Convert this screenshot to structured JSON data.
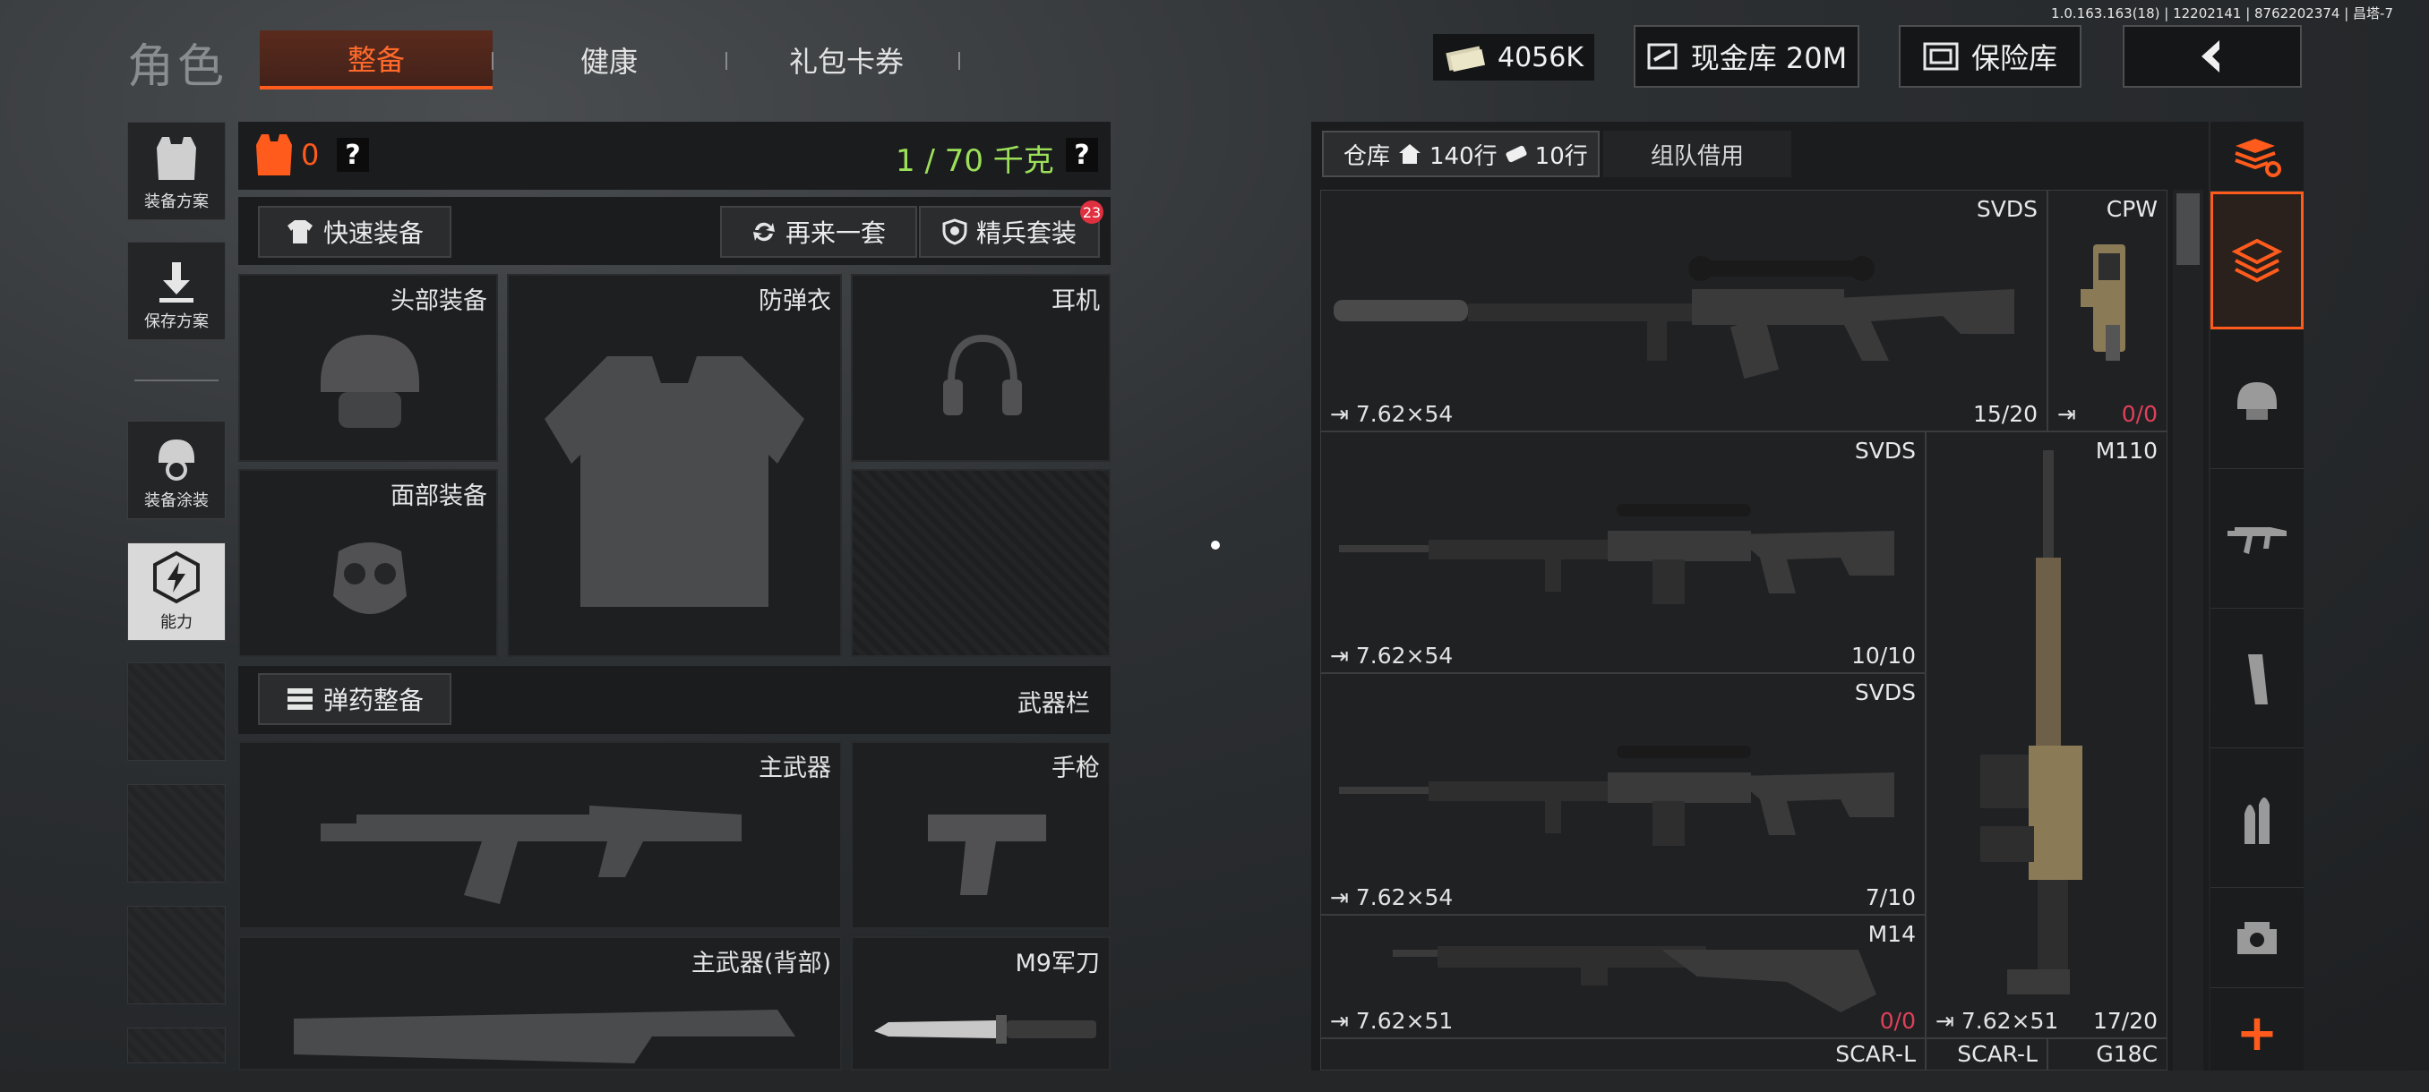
{
  "version": "1.0.163.163(18) | 12202141 | 8762202374 | 昌塔-7",
  "header": {
    "title": "角色",
    "tabs": [
      {
        "label": "整备",
        "active": true
      },
      {
        "label": "健康",
        "active": false
      },
      {
        "label": "礼包卡券",
        "active": false
      }
    ],
    "cash": "4056K",
    "cash_vault": "现金库 20M",
    "safe": "保险库"
  },
  "sidebar": {
    "items": [
      {
        "label": "装备方案",
        "icon": "vest-icon"
      },
      {
        "label": "保存方案",
        "icon": "download-icon"
      },
      {
        "label": "装备涂装",
        "icon": "helmet-paint-icon"
      },
      {
        "label": "能力",
        "icon": "ability-icon",
        "active": true
      }
    ]
  },
  "loadout": {
    "armor_value": "0",
    "help": "?",
    "weight": "1 / 70 千克",
    "quick_equip": "快速装备",
    "reequip": "再来一套",
    "elite_kit": "精兵套装",
    "elite_badge": "23",
    "slots": {
      "head": "头部装备",
      "vest": "防弹衣",
      "headset": "耳机",
      "face": "面部装备",
      "primary": "主武器",
      "pistol": "手枪",
      "primary_back": "主武器(背部)",
      "melee": "M9军刀"
    },
    "ammo_equip": "弹药整备",
    "weapon_bar": "武器栏"
  },
  "warehouse": {
    "tab_label": "仓库",
    "rows": "140行",
    "rows2": "10行",
    "team_loan": "组队借用",
    "items": [
      {
        "name": "SVDS",
        "ammo": "7.62×54",
        "count": "15/20"
      },
      {
        "name": "CPW",
        "ammo": "",
        "count": "0/0"
      },
      {
        "name": "SVDS",
        "ammo": "7.62×54",
        "count": "10/10"
      },
      {
        "name": "M110",
        "ammo": "7.62×51",
        "count": "17/20"
      },
      {
        "name": "SVDS",
        "ammo": "7.62×54",
        "count": "7/10"
      },
      {
        "name": "M14",
        "ammo": "7.62×51",
        "count": "0/0"
      },
      {
        "name": "SCAR-L",
        "ammo": "",
        "count": ""
      },
      {
        "name": "SCAR-L",
        "ammo": "",
        "count": ""
      },
      {
        "name": "G18C",
        "ammo": "",
        "count": ""
      }
    ],
    "add": "+"
  }
}
